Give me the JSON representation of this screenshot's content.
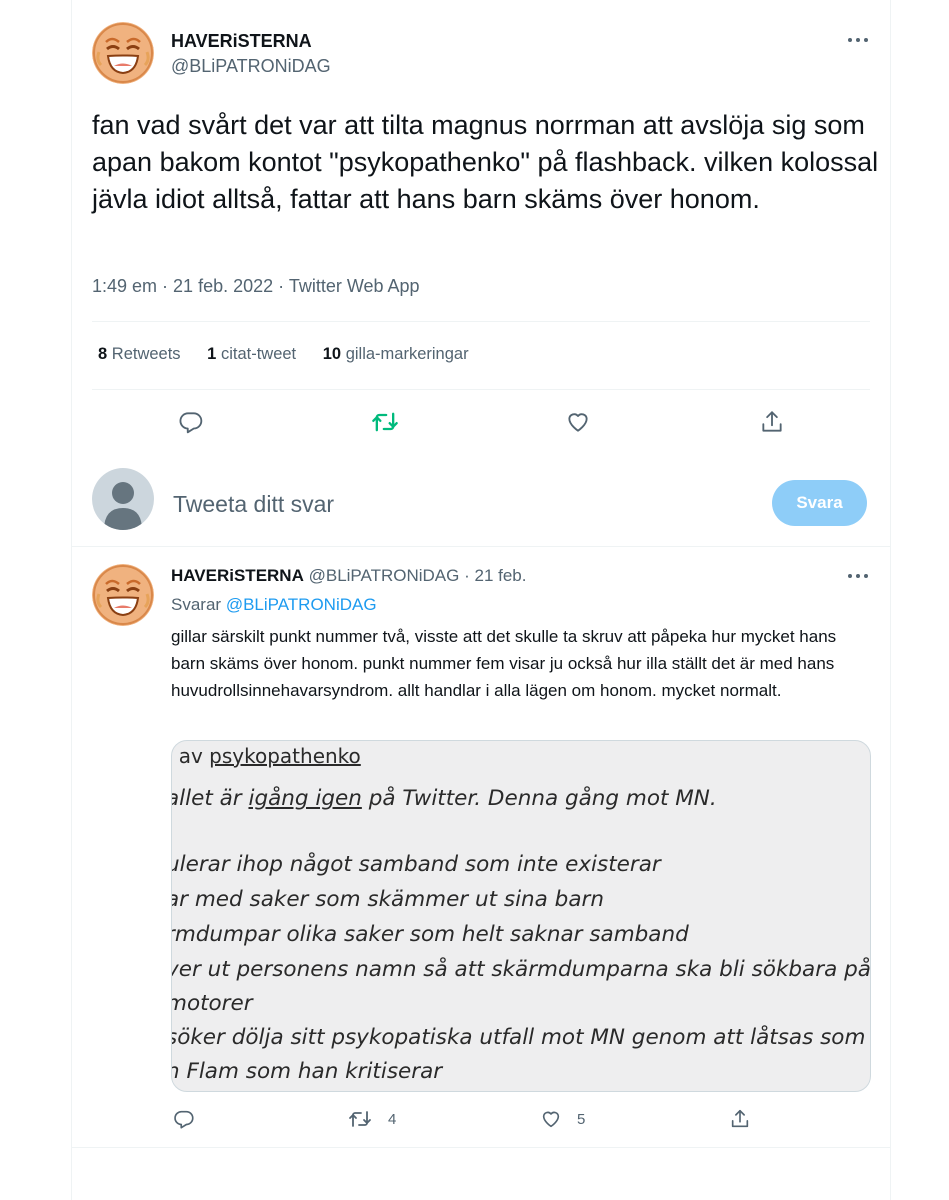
{
  "main_tweet": {
    "display_name": "HAVERiSTERNA",
    "handle": "@BLiPATRONiDAG",
    "text": "fan vad svårt det var att tilta magnus norrman att avslöja sig som apan bakom kontot \"psykopathenko\" på flashback. vilken kolossal jävla idiot alltså, fattar att hans barn skäms över honom.",
    "time": "1:49 em",
    "date": "21 feb. 2022",
    "source": "Twitter Web App",
    "separator": " · ",
    "stats": {
      "retweets_count": "8",
      "retweets_label": "Retweets",
      "quotes_count": "1",
      "quotes_label": "citat-tweet",
      "likes_count": "10",
      "likes_label": "gilla-markeringar"
    }
  },
  "compose": {
    "placeholder": "Tweeta ditt svar",
    "button_label": "Svara"
  },
  "reply_tweet": {
    "display_name": "HAVERiSTERNA",
    "handle": "@BLiPATRONiDAG",
    "date": "· 21 feb.",
    "replying_label": "Svarar",
    "replying_to": "@BLiPATRONiDAG",
    "text": "gillar särskilt punkt nummer två, visste att det skulle ta skruv att påpeka hur mycket hans barn skäms över honom. punkt nummer fem visar ju också hur illa ställt det är med hans huvudrollsinnehavarsyndrom. allt handlar i alla lägen om honom. mycket normalt.",
    "retweets_count": "4",
    "likes_count": "5",
    "image_lines": {
      "l1_prefix": "av ",
      "l1_user": "psykopathenko",
      "l2_a": "allet är ",
      "l2_u": "igång igen",
      "l2_b": " på Twitter. Denna gång mot MN.",
      "l3": "ulerar ihop något samband som inte existerar",
      "l4": "ar med saker som skämmer ut sina barn",
      "l5": "rmdumpar olika saker som helt saknar samband",
      "l6": "ver ut personens namn så att skärmdumparna ska bli sökbara på tv",
      "l7": "motorer",
      "l8": "söker dölja sitt psykopatiska utfall mot MN genom att låtsas som at",
      "l9": "n Flam som han kritiserar"
    }
  },
  "colors": {
    "accent": "#1d9bf0",
    "retweet_green": "#00ba7c",
    "secondary_text": "#536471",
    "button_disabled": "#8ecdf8"
  },
  "icons": [
    "more-icon",
    "reply-icon",
    "retweet-icon",
    "like-icon",
    "share-icon",
    "default-avatar-icon",
    "laughing-emoji-avatar"
  ]
}
